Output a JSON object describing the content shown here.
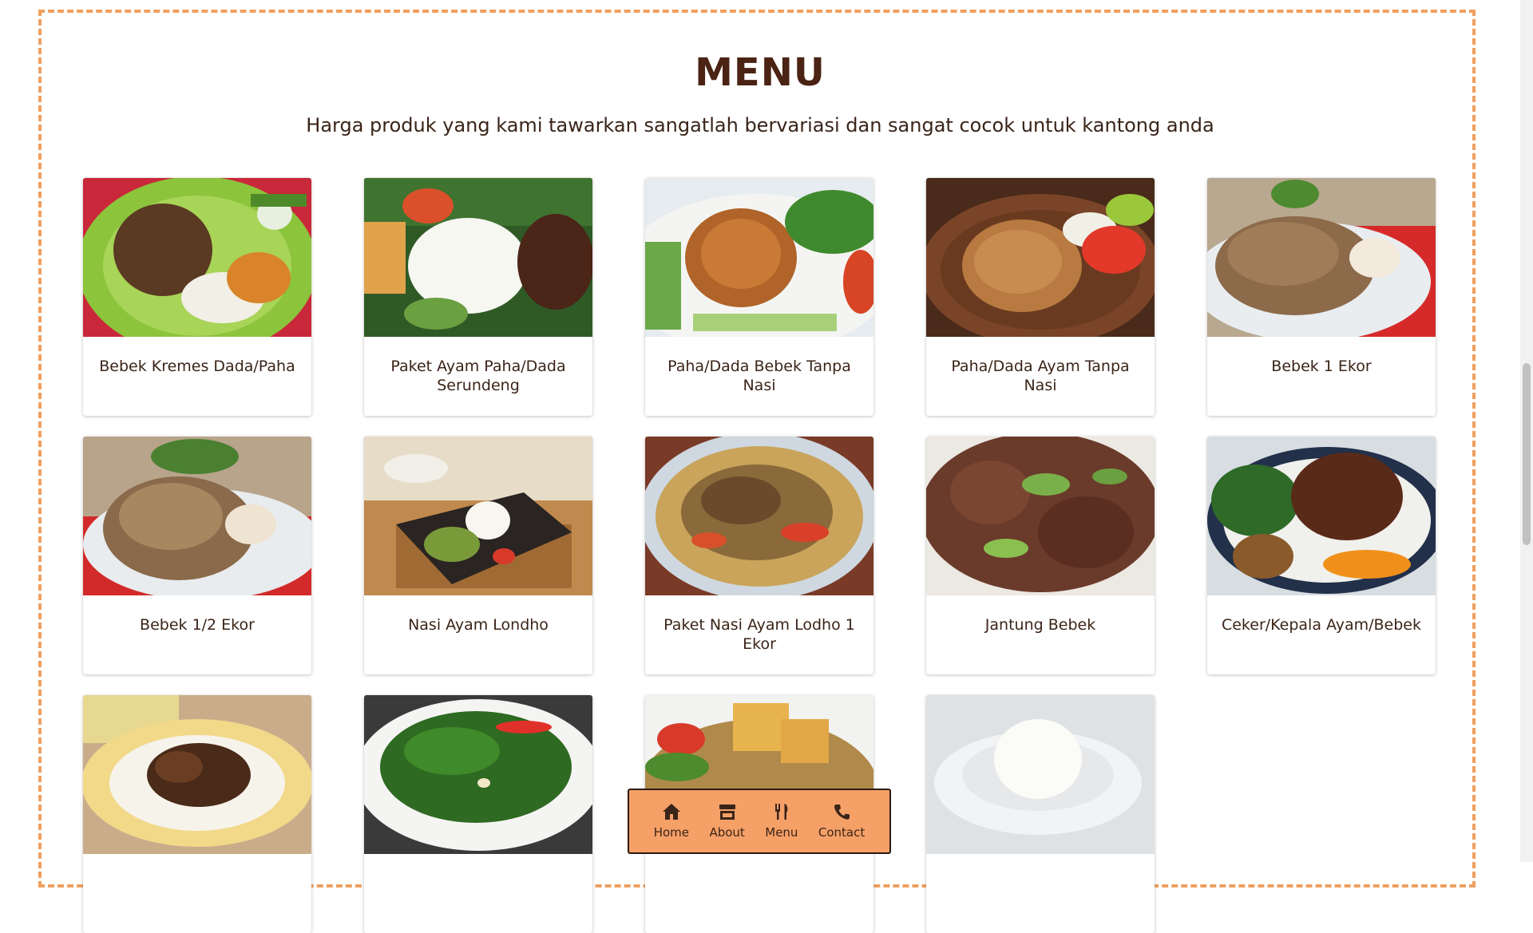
{
  "section": {
    "title": "MENU",
    "subtitle": "Harga produk yang kami tawarkan sangatlah bervariasi dan sangat cocok untuk kantong anda"
  },
  "menu_items": [
    {
      "name": "Bebek Kremes Dada/Paha"
    },
    {
      "name": "Paket Ayam Paha/Dada Serundeng"
    },
    {
      "name": "Paha/Dada Bebek Tanpa Nasi"
    },
    {
      "name": "Paha/Dada Ayam Tanpa Nasi"
    },
    {
      "name": "Bebek 1 Ekor"
    },
    {
      "name": "Bebek 1/2 Ekor"
    },
    {
      "name": "Nasi Ayam Londho"
    },
    {
      "name": "Paket Nasi Ayam Lodho 1 Ekor"
    },
    {
      "name": "Jantung Bebek"
    },
    {
      "name": "Ceker/Kepala Ayam/Bebek"
    }
  ],
  "nav": {
    "home": {
      "label": "Home",
      "icon": "home-icon"
    },
    "about": {
      "label": "About",
      "icon": "store-icon"
    },
    "menu": {
      "label": "Menu",
      "icon": "utensils-icon"
    },
    "contact": {
      "label": "Contact",
      "icon": "phone-icon"
    }
  },
  "colors": {
    "accent": "#f5a067",
    "frame_border": "#f0a060",
    "heading": "#4a2314"
  }
}
